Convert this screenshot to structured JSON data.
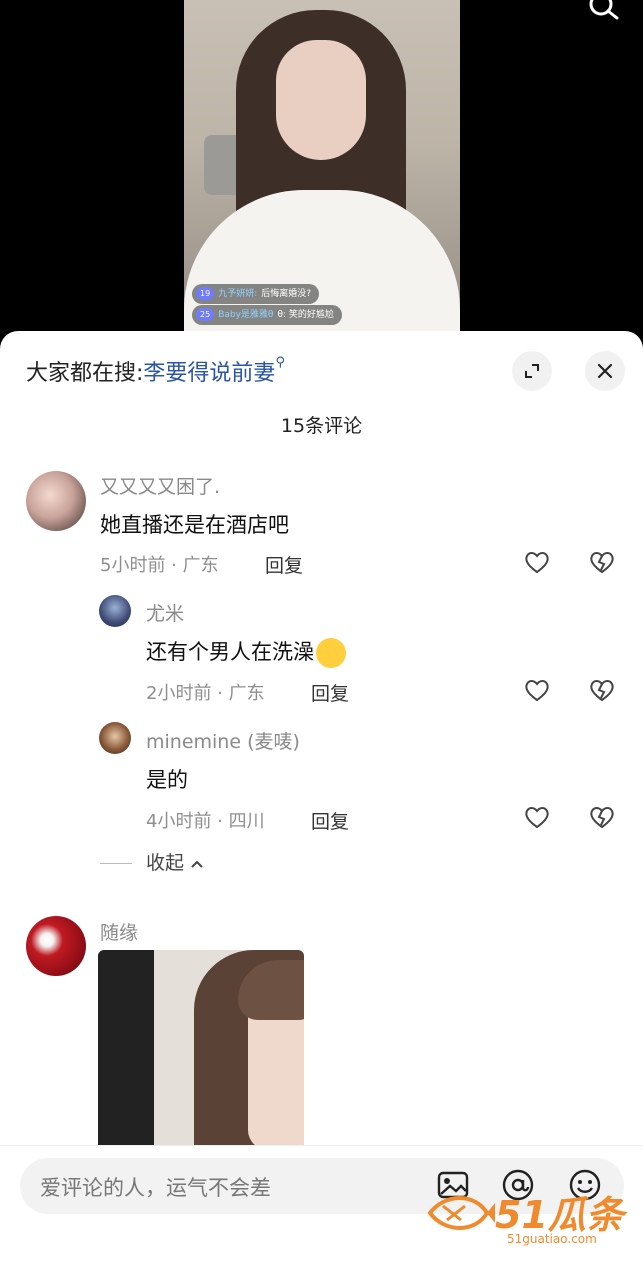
{
  "search_bar": {
    "label": "大家都在搜:",
    "term": "李要得说前妻"
  },
  "danmu": [
    {
      "level": "19",
      "user": "九予妍妍:",
      "text": "后悔离婚没?"
    },
    {
      "level": "25",
      "user": "Baby是雅雅θ",
      "text": "θ: 笑的好尴尬"
    }
  ],
  "comments_header": {
    "count": "15条评论"
  },
  "comments": [
    {
      "user": "又又又又困了.",
      "text": "她直播还是在酒店吧",
      "time_loc": "5小时前 · 广东",
      "reply_label": "回复"
    }
  ],
  "replies": [
    {
      "user": "尤米",
      "text": "还有个男人在洗澡",
      "time_loc": "2小时前 · 广东",
      "reply_label": "回复"
    },
    {
      "user": "minemine (麦唛)",
      "text": "是的",
      "time_loc": "4小时前 · 四川",
      "reply_label": "回复"
    }
  ],
  "collapse_label": "收起",
  "second_comment": {
    "user": "随缘"
  },
  "input": {
    "placeholder": "爱评论的人，运气不会差"
  },
  "watermark": {
    "brand": "51瓜条",
    "url": "51guatiao.com"
  },
  "icons": {
    "search": "search-icon",
    "expand": "expand-icon",
    "close": "close-icon",
    "like": "heart-icon",
    "dislike": "broken-heart-icon",
    "image": "image-icon",
    "mention": "at-icon",
    "emoji": "emoji-icon"
  },
  "colors": {
    "accent_link": "#2a55a6",
    "watermark": "#f08a2c"
  }
}
